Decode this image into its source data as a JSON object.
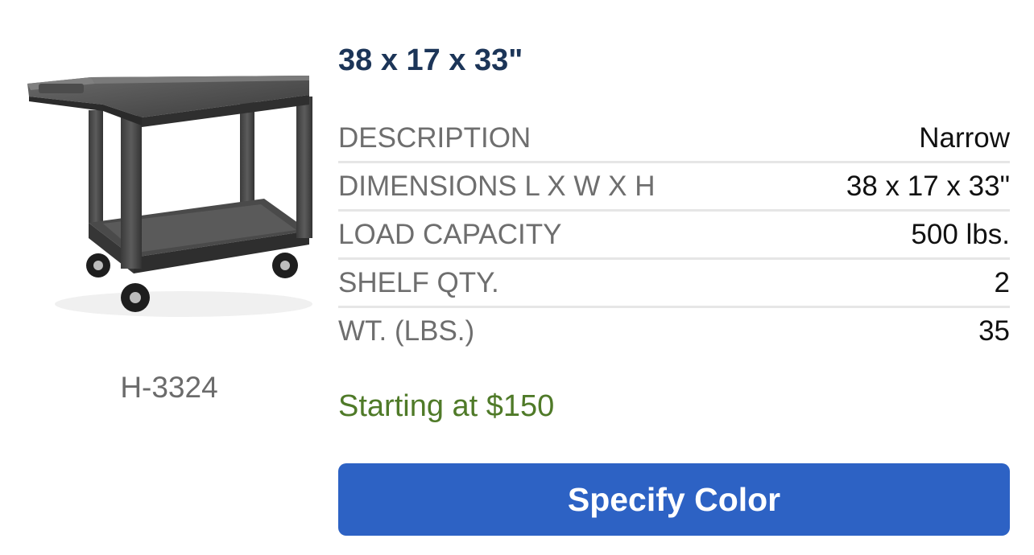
{
  "product": {
    "sku": "H-3324",
    "title": "38 x 17 x 33\"",
    "price_text": "Starting at $150",
    "cta_label": "Specify Color",
    "specs": [
      {
        "label": "DESCRIPTION",
        "value": "Narrow"
      },
      {
        "label": "DIMENSIONS L X W X H",
        "value": "38 x 17 x 33\""
      },
      {
        "label": "LOAD CAPACITY",
        "value": "500 lbs."
      },
      {
        "label": "SHELF QTY.",
        "value": "2"
      },
      {
        "label": "WT. (LBS.)",
        "value": "35"
      }
    ]
  },
  "colors": {
    "title": "#1c3558",
    "label": "#6e6e6e",
    "value": "#111111",
    "price": "#4f7a28",
    "button": "#2d62c4",
    "divider": "#e6e6e6"
  },
  "icons": {
    "product_image": "utility-cart-image"
  }
}
